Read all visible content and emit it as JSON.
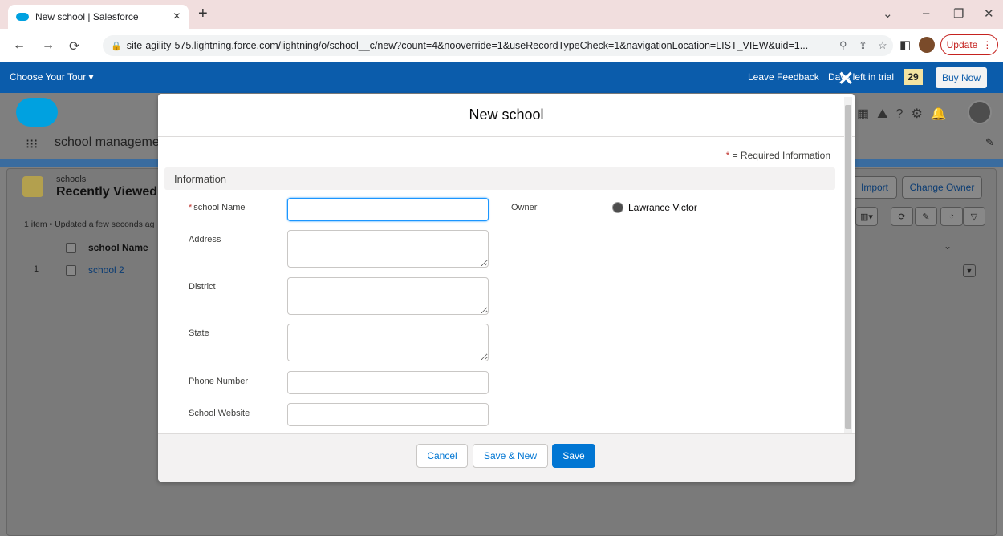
{
  "browser": {
    "tab_title": "New school | Salesforce",
    "tab_close": "×",
    "new_tab": "+",
    "url": "site-agility-575.lightning.force.com/lightning/o/school__c/new?count=4&nooverride=1&useRecordTypeCheck=1&navigationLocation=LIST_VIEW&uid=1...",
    "update_label": "Update",
    "icons": [
      "back-arrow-icon",
      "forward-arrow-icon",
      "reload-icon",
      "lock-icon",
      "zoom-icon",
      "share-icon",
      "star-icon",
      "sidebar-icon",
      "profile-icon",
      "menu-dots-icon"
    ]
  },
  "trial_bar": {
    "tour_label": "Choose Your Tour ▾",
    "feedback_label": "Leave Feedback",
    "days_label": "Days left in trial",
    "days_count": "29",
    "buy_label": "Buy Now"
  },
  "app": {
    "name": "school manageme",
    "list": {
      "object_label": "schools",
      "title": "Recently Viewed",
      "meta": "1 item • Updated a few seconds ag",
      "column": "school Name",
      "row_num": "1",
      "row_link": "school 2",
      "import_label": "Import",
      "change_owner_label": "Change Owner"
    }
  },
  "modal": {
    "title": "New school",
    "required_info": "= Required Information",
    "required_star": "*",
    "section": "Information",
    "fields": {
      "school_name": {
        "label": "school Name",
        "value": ""
      },
      "address": {
        "label": "Address"
      },
      "district": {
        "label": "District"
      },
      "state": {
        "label": "State"
      },
      "phone": {
        "label": "Phone Number"
      },
      "website": {
        "label": "School Website"
      }
    },
    "owner": {
      "label": "Owner",
      "value": "Lawrance Victor"
    },
    "buttons": {
      "cancel": "Cancel",
      "save_new": "Save & New",
      "save": "Save"
    }
  },
  "colors": {
    "brand_blue": "#0b5cab",
    "primary_button": "#0176d3",
    "required": "#c23934",
    "focus": "#1b96ff"
  }
}
